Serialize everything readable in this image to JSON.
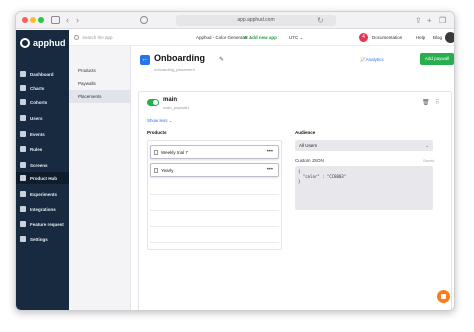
{
  "browser": {
    "url": "app.apphud.com"
  },
  "brand": {
    "name": "apphud",
    "accent": "#2574e8",
    "success": "#27ae4f",
    "sidebar_bg": "#172a3f"
  },
  "sidebar": {
    "items": [
      {
        "label": "Dashboard",
        "icon": "dashboard-icon"
      },
      {
        "label": "Charts",
        "icon": "charts-icon"
      },
      {
        "label": "Cohorts",
        "icon": "cohorts-icon"
      },
      {
        "label": "Users",
        "icon": "users-icon"
      },
      {
        "label": "Events",
        "icon": "events-icon"
      },
      {
        "label": "Rules",
        "icon": "rules-icon"
      },
      {
        "label": "Screens",
        "icon": "screens-icon"
      },
      {
        "label": "Product Hub",
        "icon": "product-hub-icon",
        "active": true
      },
      {
        "label": "Experiments",
        "icon": "experiments-icon"
      },
      {
        "label": "Integrations",
        "icon": "integrations-icon"
      },
      {
        "label": "Feature request",
        "icon": "feature-request-icon"
      },
      {
        "label": "Settings",
        "icon": "settings-icon"
      }
    ]
  },
  "subnav": {
    "items": [
      {
        "label": "Products"
      },
      {
        "label": "Paywalls"
      },
      {
        "label": "Placements",
        "active": true
      }
    ]
  },
  "topbar": {
    "search_placeholder": "Search the app",
    "app_selector": "Apphud - Color Generator",
    "add_app": "Add new app",
    "timezone": "UTC",
    "notifications": "4",
    "documentation": "Documentation",
    "help": "Help",
    "blog": "Blog"
  },
  "page": {
    "title": "Onboarding",
    "analytics": "Analytics",
    "add_paywall": "Add paywall"
  },
  "paywall": {
    "name": "main",
    "identifier": "main_paywall1",
    "show_less": "Show less",
    "products_label": "Products",
    "audience_label": "Audience",
    "products": [
      {
        "name": "Weekly trial 7"
      },
      {
        "name": "Yearly"
      }
    ],
    "audience_value": "All Users",
    "custom_json_label": "Custom JSON",
    "custom_json_status": "Saved",
    "custom_json_value": "{\n  \"color\" : \"CC8003\"\n}"
  },
  "placement_subtitle": "onboarding_placement"
}
